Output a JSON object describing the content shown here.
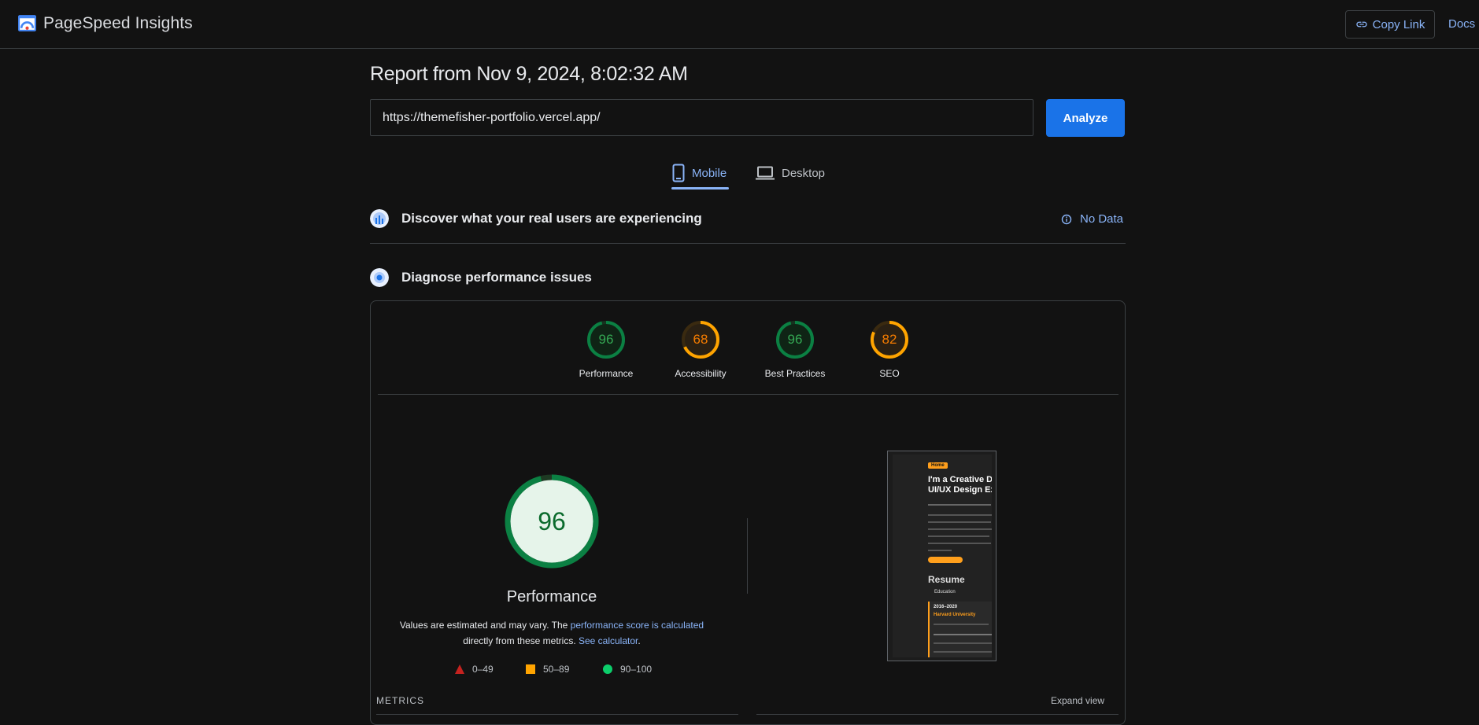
{
  "header": {
    "app_name": "PageSpeed Insights",
    "copy_link_label": "Copy Link",
    "docs_label": "Docs"
  },
  "report": {
    "title": "Report from Nov 9, 2024, 8:02:32 AM",
    "url": "https://themefisher-portfolio.vercel.app/",
    "analyze_label": "Analyze"
  },
  "tabs": [
    {
      "label": "Mobile",
      "selected": true
    },
    {
      "label": "Desktop",
      "selected": false
    }
  ],
  "field_data": {
    "title": "Discover what your real users are experiencing",
    "status": "No Data"
  },
  "diagnose": {
    "title": "Diagnose performance issues"
  },
  "scores": [
    {
      "label": "Performance",
      "value": 96,
      "color": "#0cce6b",
      "status": "pass"
    },
    {
      "label": "Accessibility",
      "value": 68,
      "color": "#ffa400",
      "status": "average"
    },
    {
      "label": "Best Practices",
      "value": 96,
      "color": "#0cce6b",
      "status": "pass"
    },
    {
      "label": "SEO",
      "value": 82,
      "color": "#ffa400",
      "status": "average"
    }
  ],
  "performance_detail": {
    "score": 96,
    "label": "Performance",
    "desc_prefix": "Values are estimated and may vary. The ",
    "desc_link1": "performance score is calculated",
    "desc_middle": " directly from these metrics. ",
    "desc_link2": "See calculator",
    "desc_suffix": "."
  },
  "legend": [
    {
      "range": "0–49",
      "shape": "triangle",
      "color": "#ff4e42"
    },
    {
      "range": "50–89",
      "shape": "square",
      "color": "#ffa400"
    },
    {
      "range": "90–100",
      "shape": "circle",
      "color": "#0cce6b"
    }
  ],
  "screenshot": {
    "pill": "Home",
    "headline_1": "I'm a Creative De",
    "headline_2": "UI/UX Design Ex",
    "resume": "Resume",
    "education": "Education",
    "years": "2016–2020",
    "university": "Harvard University"
  },
  "metrics": {
    "label": "METRICS",
    "expand_label": "Expand view"
  }
}
